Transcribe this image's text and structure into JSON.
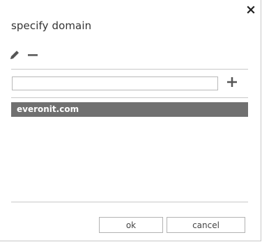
{
  "dialog": {
    "title": "specify domain",
    "close_icon": "close-icon",
    "toolbar": {
      "edit_icon": "pencil-icon",
      "remove_icon": "minus-icon"
    },
    "input": {
      "value": "",
      "placeholder": ""
    },
    "add_icon": "plus-icon",
    "domains": [
      {
        "name": "everonit.com",
        "selected": true
      }
    ],
    "buttons": {
      "ok_label": "ok",
      "cancel_label": "cancel"
    },
    "colors": {
      "selected_row_bg": "#707070",
      "selected_row_text": "#ffffff",
      "separator": "#c8c8c8",
      "icon": "#555555"
    }
  }
}
